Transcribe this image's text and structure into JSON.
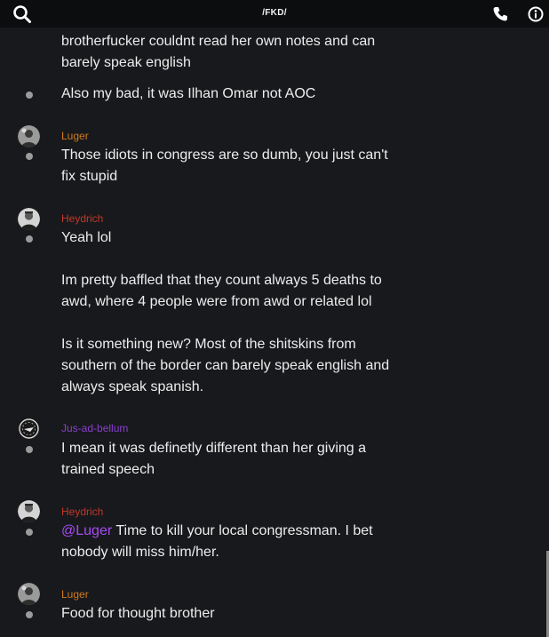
{
  "header": {
    "title": "/FKD/",
    "icons": [
      "search-icon",
      "phone-icon",
      "info-icon"
    ]
  },
  "colors": {
    "background": "#18191c",
    "topbar": "#0c0d0f",
    "luger": "#d17a1e",
    "heydrich": "#c0392b",
    "jus_ad_bellum": "#8a3fd1",
    "mention": "#a64bf4"
  },
  "messages": [
    {
      "lines": [
        "brotherfucker couldnt read her own notes and can",
        "barely speak english"
      ]
    },
    {
      "lines": [
        "Also my bad, it was Ilhan Omar not  AOC"
      ]
    },
    {
      "author": "Luger",
      "lines": [
        "Those idiots in congress are so dumb, you just can't",
        "fix stupid"
      ]
    },
    {
      "author": "Heydrich",
      "lines": [
        "Yeah lol",
        "Im pretty baffled that they count always 5 deaths to",
        "awd, where 4 people were from awd or related lol",
        "Is it something new? Most of the shitskins from",
        "southern of the border can barely speak english and",
        "always speak spanish."
      ]
    },
    {
      "author": "Jus-ad-bellum",
      "lines": [
        "I mean it was definetly different than her giving a",
        "trained speech"
      ]
    },
    {
      "author": "Heydrich",
      "mention": "@Luger",
      "lines": [
        " Time to kill your local congressman. I bet",
        "nobody will miss him/her."
      ]
    },
    {
      "author": "Luger",
      "lines": [
        "Food for thought brother"
      ]
    }
  ]
}
